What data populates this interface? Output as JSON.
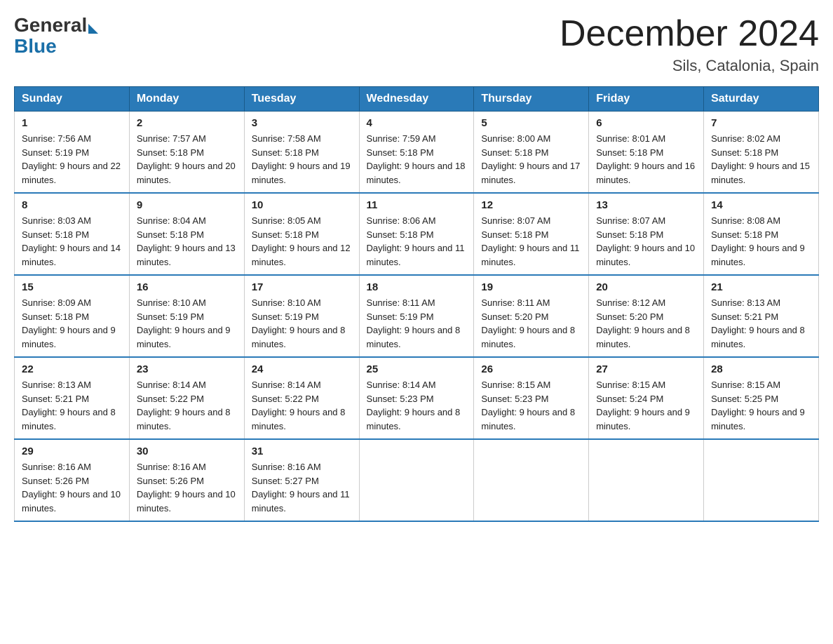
{
  "logo": {
    "general": "General",
    "blue": "Blue"
  },
  "title": "December 2024",
  "subtitle": "Sils, Catalonia, Spain",
  "days_of_week": [
    "Sunday",
    "Monday",
    "Tuesday",
    "Wednesday",
    "Thursday",
    "Friday",
    "Saturday"
  ],
  "weeks": [
    [
      {
        "day": "1",
        "sunrise": "7:56 AM",
        "sunset": "5:19 PM",
        "daylight": "9 hours and 22 minutes."
      },
      {
        "day": "2",
        "sunrise": "7:57 AM",
        "sunset": "5:18 PM",
        "daylight": "9 hours and 20 minutes."
      },
      {
        "day": "3",
        "sunrise": "7:58 AM",
        "sunset": "5:18 PM",
        "daylight": "9 hours and 19 minutes."
      },
      {
        "day": "4",
        "sunrise": "7:59 AM",
        "sunset": "5:18 PM",
        "daylight": "9 hours and 18 minutes."
      },
      {
        "day": "5",
        "sunrise": "8:00 AM",
        "sunset": "5:18 PM",
        "daylight": "9 hours and 17 minutes."
      },
      {
        "day": "6",
        "sunrise": "8:01 AM",
        "sunset": "5:18 PM",
        "daylight": "9 hours and 16 minutes."
      },
      {
        "day": "7",
        "sunrise": "8:02 AM",
        "sunset": "5:18 PM",
        "daylight": "9 hours and 15 minutes."
      }
    ],
    [
      {
        "day": "8",
        "sunrise": "8:03 AM",
        "sunset": "5:18 PM",
        "daylight": "9 hours and 14 minutes."
      },
      {
        "day": "9",
        "sunrise": "8:04 AM",
        "sunset": "5:18 PM",
        "daylight": "9 hours and 13 minutes."
      },
      {
        "day": "10",
        "sunrise": "8:05 AM",
        "sunset": "5:18 PM",
        "daylight": "9 hours and 12 minutes."
      },
      {
        "day": "11",
        "sunrise": "8:06 AM",
        "sunset": "5:18 PM",
        "daylight": "9 hours and 11 minutes."
      },
      {
        "day": "12",
        "sunrise": "8:07 AM",
        "sunset": "5:18 PM",
        "daylight": "9 hours and 11 minutes."
      },
      {
        "day": "13",
        "sunrise": "8:07 AM",
        "sunset": "5:18 PM",
        "daylight": "9 hours and 10 minutes."
      },
      {
        "day": "14",
        "sunrise": "8:08 AM",
        "sunset": "5:18 PM",
        "daylight": "9 hours and 9 minutes."
      }
    ],
    [
      {
        "day": "15",
        "sunrise": "8:09 AM",
        "sunset": "5:18 PM",
        "daylight": "9 hours and 9 minutes."
      },
      {
        "day": "16",
        "sunrise": "8:10 AM",
        "sunset": "5:19 PM",
        "daylight": "9 hours and 9 minutes."
      },
      {
        "day": "17",
        "sunrise": "8:10 AM",
        "sunset": "5:19 PM",
        "daylight": "9 hours and 8 minutes."
      },
      {
        "day": "18",
        "sunrise": "8:11 AM",
        "sunset": "5:19 PM",
        "daylight": "9 hours and 8 minutes."
      },
      {
        "day": "19",
        "sunrise": "8:11 AM",
        "sunset": "5:20 PM",
        "daylight": "9 hours and 8 minutes."
      },
      {
        "day": "20",
        "sunrise": "8:12 AM",
        "sunset": "5:20 PM",
        "daylight": "9 hours and 8 minutes."
      },
      {
        "day": "21",
        "sunrise": "8:13 AM",
        "sunset": "5:21 PM",
        "daylight": "9 hours and 8 minutes."
      }
    ],
    [
      {
        "day": "22",
        "sunrise": "8:13 AM",
        "sunset": "5:21 PM",
        "daylight": "9 hours and 8 minutes."
      },
      {
        "day": "23",
        "sunrise": "8:14 AM",
        "sunset": "5:22 PM",
        "daylight": "9 hours and 8 minutes."
      },
      {
        "day": "24",
        "sunrise": "8:14 AM",
        "sunset": "5:22 PM",
        "daylight": "9 hours and 8 minutes."
      },
      {
        "day": "25",
        "sunrise": "8:14 AM",
        "sunset": "5:23 PM",
        "daylight": "9 hours and 8 minutes."
      },
      {
        "day": "26",
        "sunrise": "8:15 AM",
        "sunset": "5:23 PM",
        "daylight": "9 hours and 8 minutes."
      },
      {
        "day": "27",
        "sunrise": "8:15 AM",
        "sunset": "5:24 PM",
        "daylight": "9 hours and 9 minutes."
      },
      {
        "day": "28",
        "sunrise": "8:15 AM",
        "sunset": "5:25 PM",
        "daylight": "9 hours and 9 minutes."
      }
    ],
    [
      {
        "day": "29",
        "sunrise": "8:16 AM",
        "sunset": "5:26 PM",
        "daylight": "9 hours and 10 minutes."
      },
      {
        "day": "30",
        "sunrise": "8:16 AM",
        "sunset": "5:26 PM",
        "daylight": "9 hours and 10 minutes."
      },
      {
        "day": "31",
        "sunrise": "8:16 AM",
        "sunset": "5:27 PM",
        "daylight": "9 hours and 11 minutes."
      },
      null,
      null,
      null,
      null
    ]
  ]
}
